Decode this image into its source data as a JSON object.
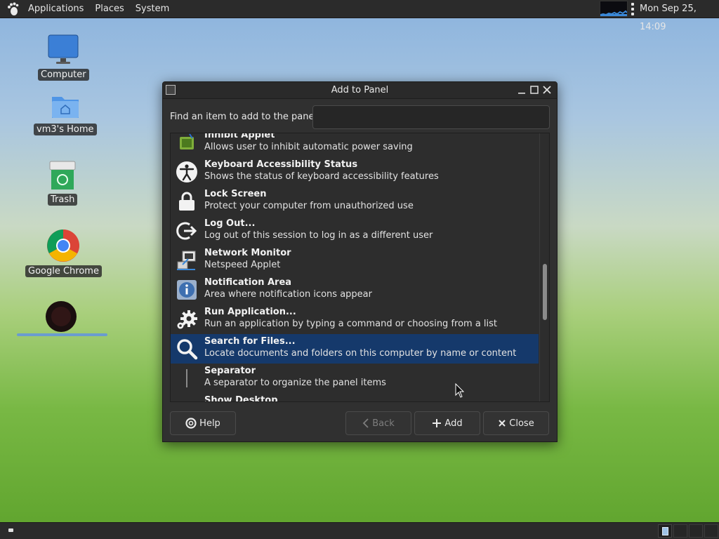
{
  "top_panel": {
    "menus": [
      "Applications",
      "Places",
      "System"
    ],
    "clock": "Mon Sep 25, 14:09"
  },
  "desktop": {
    "icons": [
      {
        "label": "Computer",
        "icon": "computer-icon"
      },
      {
        "label": "vm3's Home",
        "icon": "home-folder-icon"
      },
      {
        "label": "Trash",
        "icon": "trash-icon"
      },
      {
        "label": "Google Chrome",
        "icon": "chrome-icon"
      },
      {
        "label": "",
        "icon": "dark-orb-icon"
      }
    ]
  },
  "dialog": {
    "title": "Add to Panel",
    "find_label": "Find an item to add to the panel:",
    "find_value": "",
    "items": [
      {
        "name": "Inhibit Applet",
        "desc": "Allows user to inhibit automatic power saving",
        "icon": "inhibit-icon"
      },
      {
        "name": "Keyboard Accessibility Status",
        "desc": "Shows the status of keyboard accessibility features",
        "icon": "accessibility-icon"
      },
      {
        "name": "Lock Screen",
        "desc": "Protect your computer from unauthorized use",
        "icon": "lock-icon"
      },
      {
        "name": "Log Out...",
        "desc": "Log out of this session to log in as a different user",
        "icon": "logout-icon"
      },
      {
        "name": "Network Monitor",
        "desc": "Netspeed Applet",
        "icon": "network-monitor-icon"
      },
      {
        "name": "Notification Area",
        "desc": "Area where notification icons appear",
        "icon": "info-icon"
      },
      {
        "name": "Run Application...",
        "desc": "Run an application by typing a command or choosing from a list",
        "icon": "gear-icon"
      },
      {
        "name": "Search for Files...",
        "desc": "Locate documents and folders on this computer by name or content",
        "icon": "search-icon",
        "selected": true
      },
      {
        "name": "Separator",
        "desc": "A separator to organize the panel items",
        "icon": "separator-icon"
      },
      {
        "name": "Show Desktop",
        "desc": "",
        "icon": "show-desktop-icon"
      }
    ],
    "buttons": {
      "help": "Help",
      "back": "Back",
      "add": "Add",
      "close": "Close"
    }
  }
}
